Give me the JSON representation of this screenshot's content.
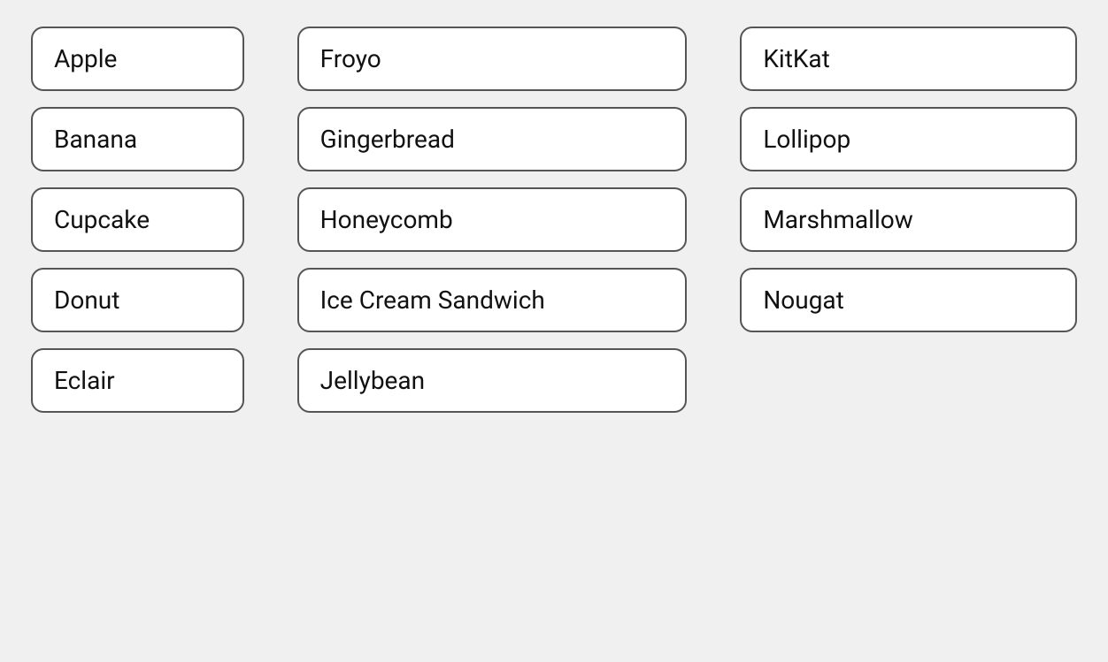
{
  "columns": [
    {
      "id": "col1",
      "items": [
        {
          "id": "apple",
          "label": "Apple"
        },
        {
          "id": "banana",
          "label": "Banana"
        },
        {
          "id": "cupcake",
          "label": "Cupcake"
        },
        {
          "id": "donut",
          "label": "Donut"
        },
        {
          "id": "eclair",
          "label": "Eclair"
        }
      ]
    },
    {
      "id": "col2",
      "items": [
        {
          "id": "froyo",
          "label": "Froyo"
        },
        {
          "id": "gingerbread",
          "label": "Gingerbread"
        },
        {
          "id": "honeycomb",
          "label": "Honeycomb"
        },
        {
          "id": "ice-cream-sandwich",
          "label": "Ice Cream Sandwich",
          "wide": true
        },
        {
          "id": "jellybean",
          "label": "Jellybean"
        }
      ]
    },
    {
      "id": "col3",
      "items": [
        {
          "id": "kitkat",
          "label": "KitKat"
        },
        {
          "id": "lollipop",
          "label": "Lollipop"
        },
        {
          "id": "marshmallow",
          "label": "Marshmallow",
          "wide": true
        },
        {
          "id": "nougat",
          "label": "Nougat"
        }
      ]
    }
  ]
}
